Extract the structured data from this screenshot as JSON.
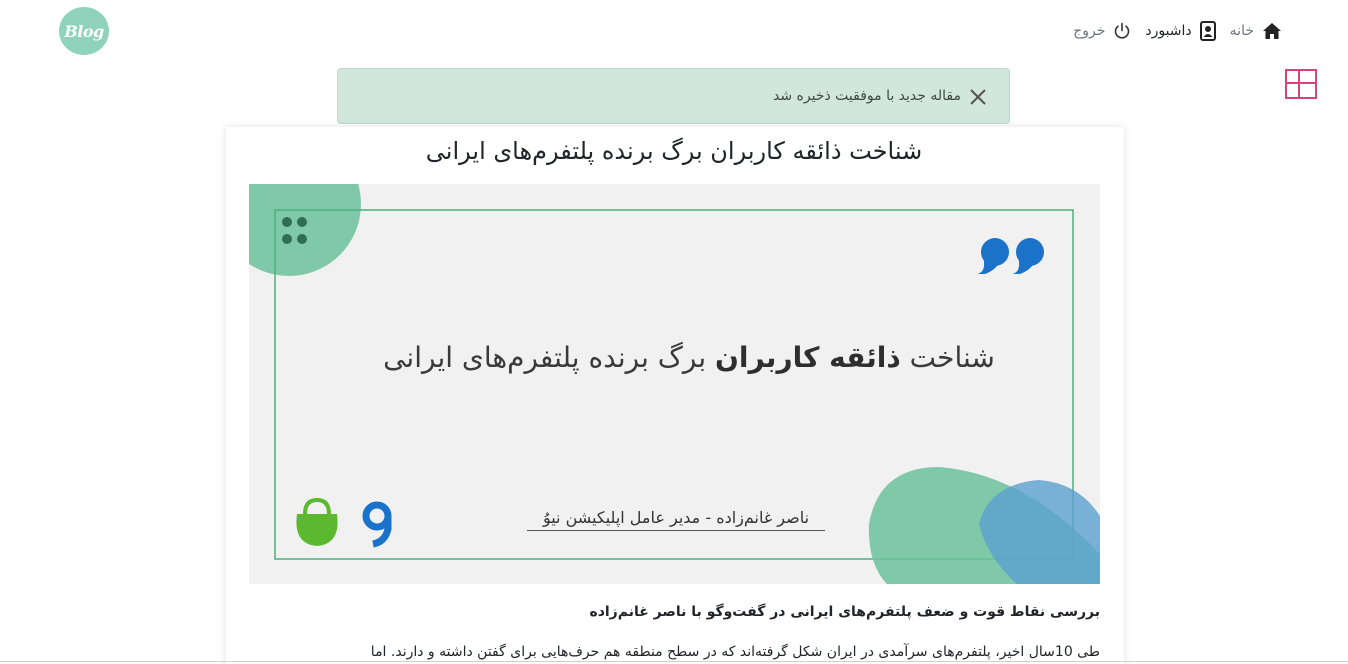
{
  "header": {
    "logo_text": "Blog",
    "nav": {
      "home_label": "خانه",
      "dashboard_label": "داشبورد",
      "logout_label": "خروج"
    }
  },
  "icons": {
    "home": "home-icon",
    "dashboard": "id-badge-icon",
    "logout": "power-icon",
    "layout": "layout-grid-icon",
    "close": "close-icon"
  },
  "alert": {
    "message": "مقاله جدید با موفقیت ذخیره شد"
  },
  "post": {
    "title": "شناخت ذائقه کاربران برگ برنده پلتفرم‌های ایرانی",
    "banner": {
      "heading_prefix": "شناخت ",
      "heading_bold": "ذائقه کاربران",
      "heading_suffix": " برگ برنده پلتفرم‌های ایرانی",
      "caption": "ناصر غانم‌زاده - مدیر عامل اپلیکیشن نیوُ"
    },
    "subtitle": "بررسی نقاط قوت و ضعف پلتفرم‌های ایرانی در گفت‌وگو با ناصر غانم‌زاده",
    "body_start": "طی 10سال اخیر، پلتفرم‌های سرآمدی در ایران شکل گرفته‌اند که در سطح منطقه هم حرف‌هایی برای گفتن داشته و دارند. اما"
  },
  "colors": {
    "logo_bg": "#8fd3bd",
    "alert_bg": "#d1e7dd",
    "layout_icon": "#d6457a",
    "banner_green": "#6cc29b",
    "banner_blue": "#5aa0d0",
    "quote_blue": "#1a73c9",
    "bazaar_green": "#5cb82f"
  }
}
